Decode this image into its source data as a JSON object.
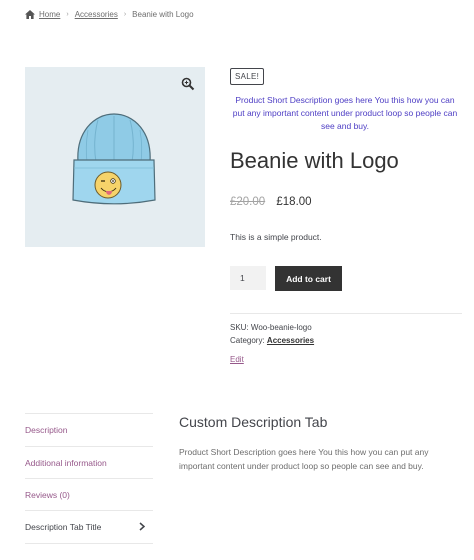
{
  "breadcrumb": {
    "home": "Home",
    "category": "Accessories",
    "current": "Beanie with Logo",
    "separator": "›"
  },
  "product": {
    "sale_badge": "SALE!",
    "short_description": "Product Short Description goes here You this how you can put any important content under product loop so people can see and buy.",
    "title": "Beanie with Logo",
    "old_price": "£20.00",
    "new_price": "£18.00",
    "description": "This is a simple product.",
    "quantity": "1",
    "add_to_cart": "Add to cart",
    "sku_label": "SKU:",
    "sku": "Woo-beanie-logo",
    "category_label": "Category:",
    "category": "Accessories",
    "edit": "Edit"
  },
  "tabs": {
    "items": [
      "Description",
      "Additional information",
      "Reviews (0)",
      "Description Tab Title"
    ],
    "active_index": 3
  },
  "panel": {
    "title": "Custom Description Tab",
    "text": "Product Short Description goes here You this how you can put any important content under product loop so people can see and buy."
  },
  "colors": {
    "link_purple": "#96588a",
    "short_desc_blue": "#4d3dc4",
    "image_bg": "#e5edf1",
    "button_dark": "#333333"
  },
  "icons": {
    "home": "home-icon",
    "zoom": "magnifier-icon",
    "chevron": "chevron-right-icon"
  }
}
